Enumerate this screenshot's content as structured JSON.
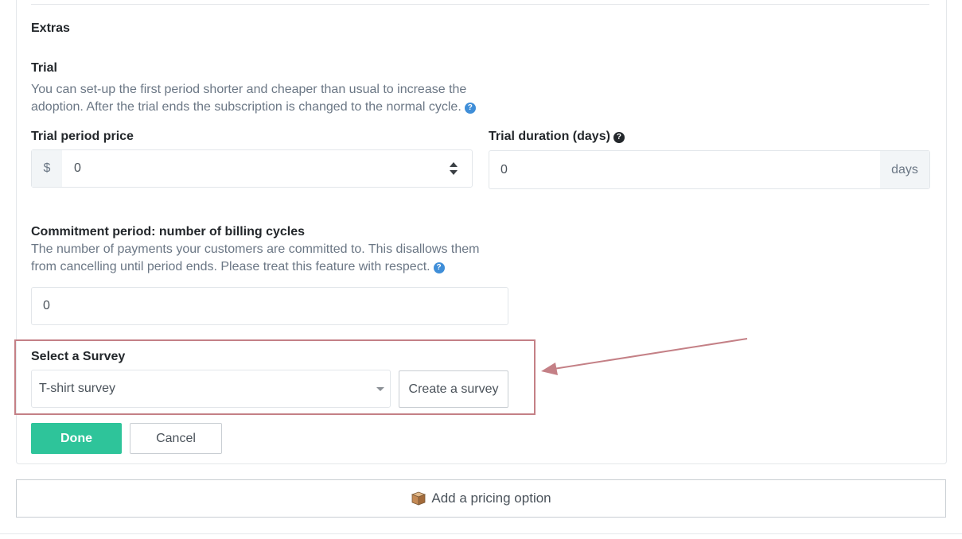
{
  "extras": {
    "heading": "Extras"
  },
  "trial": {
    "heading": "Trial",
    "description_line1": "You can set-up the first period shorter and cheaper than usual to increase the",
    "description_line2": "adoption. After the trial ends the subscription is changed to the normal cycle.",
    "help_icon": "question-circle-icon"
  },
  "trial_price": {
    "label": "Trial period price",
    "currency": "$",
    "value": "0"
  },
  "trial_duration": {
    "label": "Trial duration (days)",
    "value": "0",
    "suffix": "days",
    "help_icon": "question-circle-icon"
  },
  "commitment": {
    "heading": "Commitment period: number of billing cycles",
    "description_line1": "The number of payments your customers are committed to. This disallows them",
    "description_line2": "from cancelling until period ends. Please treat this feature with respect.",
    "value": "0",
    "help_icon": "question-circle-icon"
  },
  "survey": {
    "label": "Select a Survey",
    "selected": "T-shirt survey",
    "create_label": "Create a survey"
  },
  "actions": {
    "done_label": "Done",
    "cancel_label": "Cancel"
  },
  "add_pricing": {
    "label": "Add a pricing option",
    "icon": "box-icon"
  },
  "colors": {
    "accent": "#2ec49a",
    "help": "#3f8ed8",
    "highlight": "#c48086"
  }
}
